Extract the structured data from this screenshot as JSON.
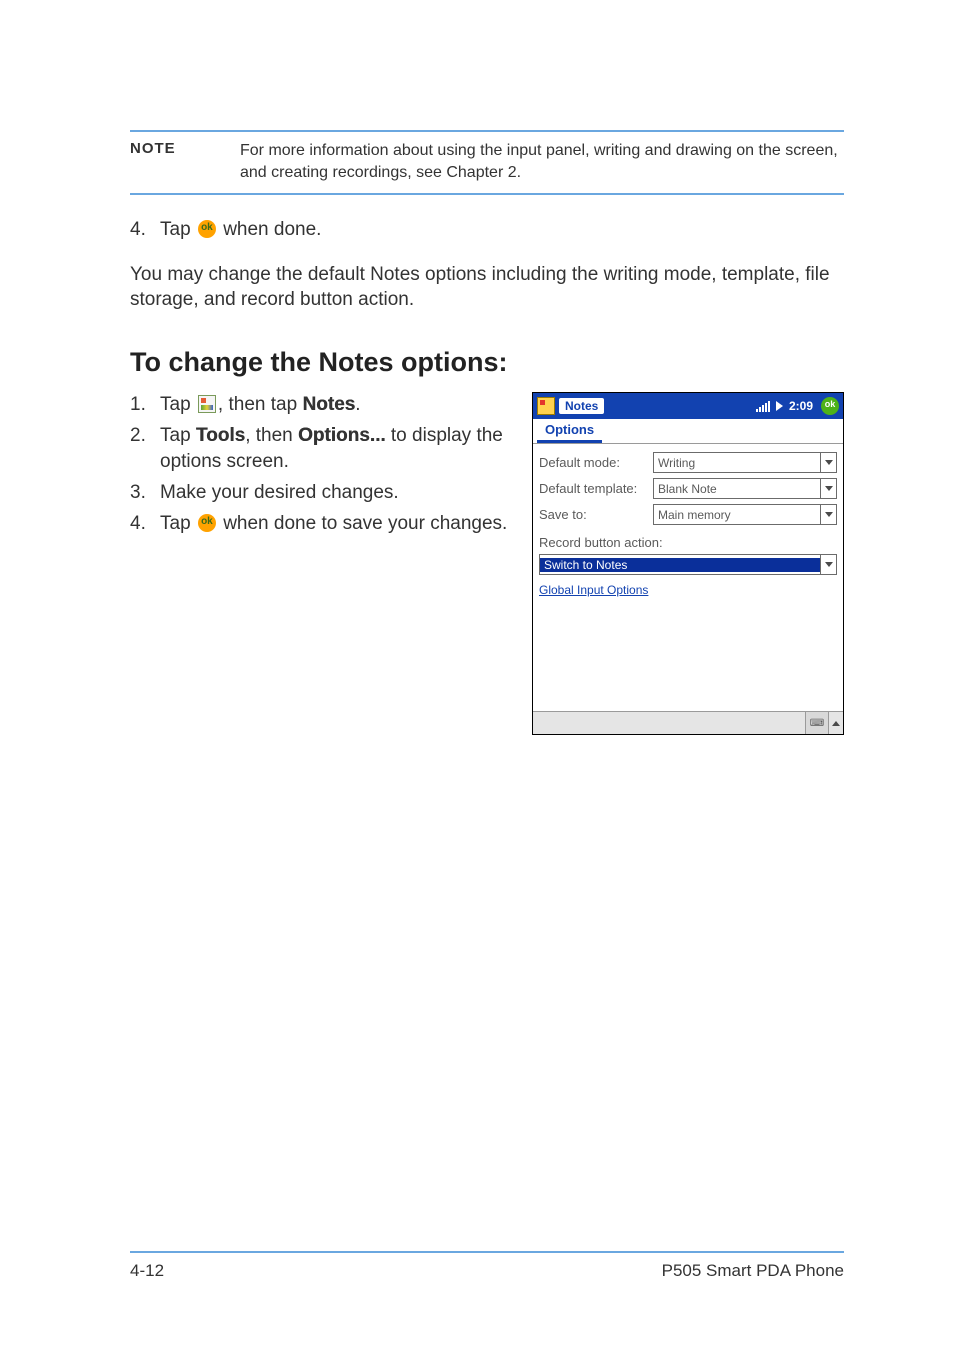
{
  "note": {
    "label": "NOTE",
    "text": "For more information about using the input panel, writing and drawing on the screen, and creating recordings, see Chapter 2."
  },
  "upper_steps": {
    "s4a": "4.",
    "s4b_pre": "Tap ",
    "s4b_post": " when done."
  },
  "para1": "You may change the default Notes options including the writing mode, template, file storage, and record button action.",
  "heading": "To change the Notes options:",
  "steps": {
    "s1_num": "1.",
    "s1_pre": "Tap ",
    "s1_mid": ", then tap ",
    "s1_bold": "Notes",
    "s1_end": ".",
    "s2_num": "2.",
    "s2_pre": "Tap ",
    "s2_b1": "Tools",
    "s2_mid": ", then ",
    "s2_b2": "Options...",
    "s2_post": " to display the options screen.",
    "s3_num": "3.",
    "s3_text": "Make your desired changes.",
    "s4_num": "4.",
    "s4_pre": "Tap ",
    "s4_post": " when done to save your changes."
  },
  "screenshot": {
    "app": "Notes",
    "time": "2:09",
    "tab": "Options",
    "default_mode_label": "Default mode:",
    "default_mode": "Writing",
    "default_template_label": "Default template:",
    "default_template": "Blank Note",
    "save_to_label": "Save to:",
    "save_to": "Main memory",
    "record_label": "Record button action:",
    "record_value": "Switch to Notes",
    "link": "Global Input Options",
    "kb_label": "⌨"
  },
  "footer": {
    "left": "4-12",
    "right": "P505 Smart PDA Phone"
  }
}
